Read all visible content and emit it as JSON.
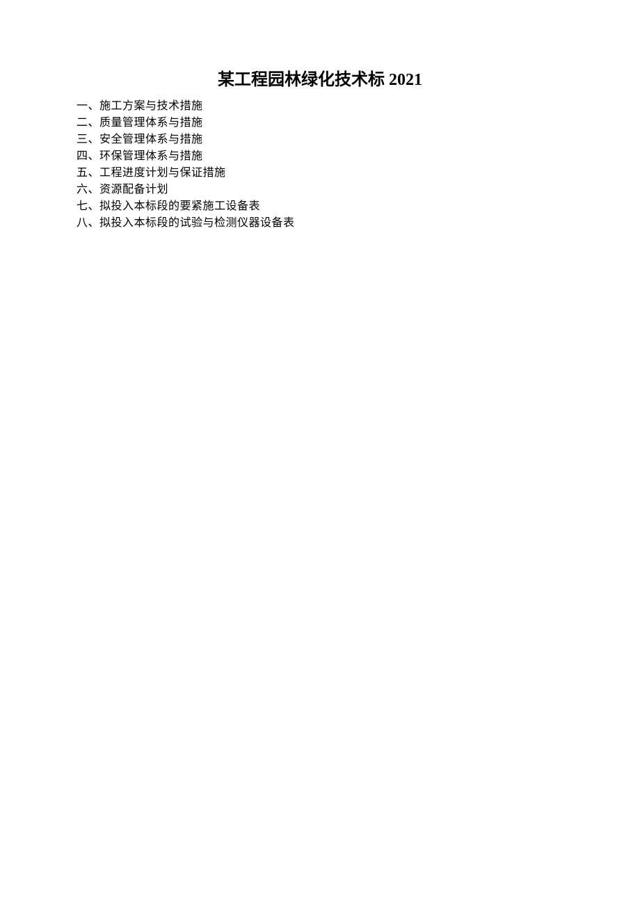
{
  "title": "某工程园林绿化技术标 2021",
  "toc": {
    "items": [
      "一、施工方案与技术措施",
      "二、质量管理体系与措施",
      "三、安全管理体系与措施",
      "四、环保管理体系与措施",
      "五、工程进度计划与保证措施",
      "六、资源配备计划",
      "七、拟投入本标段的要紧施工设备表",
      "八、拟投入本标段的试验与检测仪器设备表"
    ]
  }
}
